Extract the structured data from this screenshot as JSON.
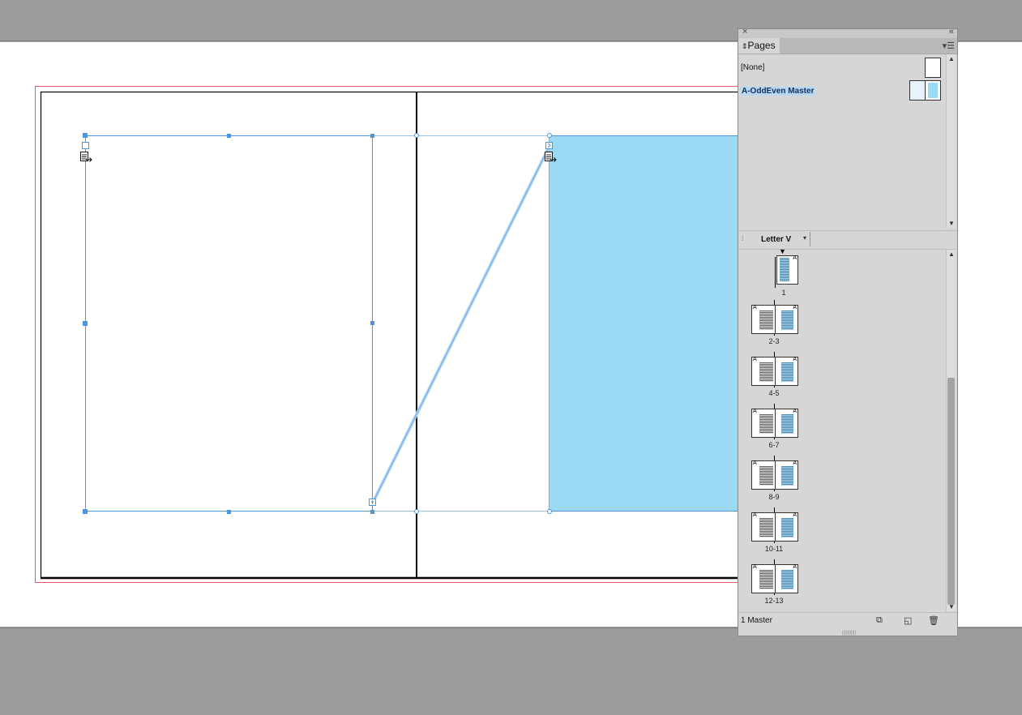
{
  "pages_panel": {
    "tab_label": "Pages",
    "masters": [
      {
        "label": "[None]"
      },
      {
        "label": "A-OddEven Master"
      }
    ],
    "page_size": "Letter V",
    "spreads": [
      {
        "label": "1"
      },
      {
        "label": "2-3"
      },
      {
        "label": "4-5"
      },
      {
        "label": "6-7"
      },
      {
        "label": "8-9"
      },
      {
        "label": "10-11"
      },
      {
        "label": "12-13"
      }
    ],
    "status": "1 Master",
    "master_prefix": "A"
  },
  "colors": {
    "workspace": "#9c9c9c",
    "selection": "#4a96e0",
    "fill": "#9bd9f5",
    "bleed": "#e35a6e"
  }
}
